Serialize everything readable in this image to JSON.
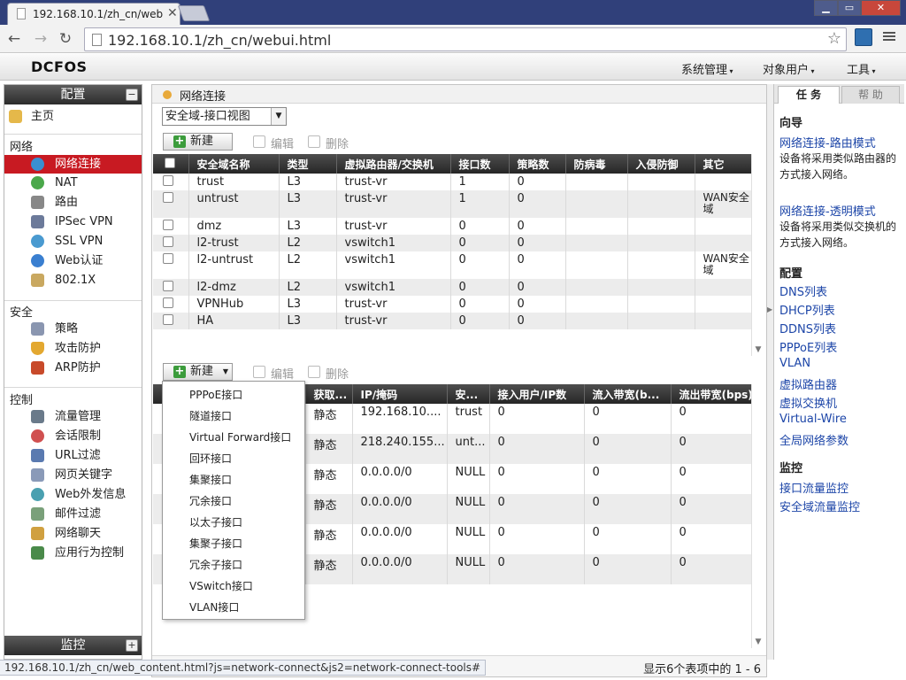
{
  "browser": {
    "tab_title": "192.168.10.1/zh_cn/web",
    "address": "192.168.10.1/zh_cn/webui.html",
    "status_url": "192.168.10.1/zh_cn/web_content.html?js=network-connect&js2=network-connect-tools#"
  },
  "app": {
    "logo": "DCFOS",
    "menus": [
      "系统管理",
      "对象用户",
      "工具"
    ]
  },
  "left": {
    "config_title": "配置",
    "monitor_title": "监控",
    "home": "主页",
    "sections": {
      "network": "网络",
      "security": "安全",
      "control": "控制"
    },
    "network_items": [
      "网络连接",
      "NAT",
      "路由",
      "IPSec VPN",
      "SSL VPN",
      "Web认证",
      "802.1X"
    ],
    "security_items": [
      "策略",
      "攻击防护",
      "ARP防护"
    ],
    "control_items": [
      "流量管理",
      "会话限制",
      "URL过滤",
      "网页关键字",
      "Web外发信息",
      "邮件过滤",
      "网络聊天",
      "应用行为控制"
    ]
  },
  "main": {
    "breadcrumb": "网络连接",
    "view_select": "安全域-接口视图",
    "new_label": "新建",
    "edit_label": "编辑",
    "delete_label": "删除",
    "zone_headers": [
      "安全域名称",
      "类型",
      "虚拟路由器/交换机",
      "接口数",
      "策略数",
      "防病毒",
      "入侵防御",
      "其它"
    ],
    "zones": [
      {
        "name": "trust",
        "type": "L3",
        "vr": "trust-vr",
        "ifc": "1",
        "pol": "0",
        "other": ""
      },
      {
        "name": "untrust",
        "type": "L3",
        "vr": "trust-vr",
        "ifc": "1",
        "pol": "0",
        "other": "WAN安全域"
      },
      {
        "name": "dmz",
        "type": "L3",
        "vr": "trust-vr",
        "ifc": "0",
        "pol": "0",
        "other": ""
      },
      {
        "name": "l2-trust",
        "type": "L2",
        "vr": "vswitch1",
        "ifc": "0",
        "pol": "0",
        "other": ""
      },
      {
        "name": "l2-untrust",
        "type": "L2",
        "vr": "vswitch1",
        "ifc": "0",
        "pol": "0",
        "other": "WAN安全域"
      },
      {
        "name": "l2-dmz",
        "type": "L2",
        "vr": "vswitch1",
        "ifc": "0",
        "pol": "0",
        "other": ""
      },
      {
        "name": "VPNHub",
        "type": "L3",
        "vr": "trust-vr",
        "ifc": "0",
        "pol": "0",
        "other": ""
      },
      {
        "name": "HA",
        "type": "L3",
        "vr": "trust-vr",
        "ifc": "0",
        "pol": "0",
        "other": ""
      }
    ],
    "if_headers": [
      "获取...",
      "IP/掩码",
      "安...",
      "接入用户/IP数",
      "流入带宽(b...",
      "流出带宽(bps)"
    ],
    "interfaces": [
      {
        "mode": "静态",
        "ip": "192.168.10....",
        "zone": "trust",
        "users": "0",
        "in": "0",
        "out": "0"
      },
      {
        "mode": "静态",
        "ip": "218.240.155...",
        "zone": "unt...",
        "users": "0",
        "in": "0",
        "out": "0"
      },
      {
        "mode": "静态",
        "ip": "0.0.0.0/0",
        "zone": "NULL",
        "users": "0",
        "in": "0",
        "out": "0"
      },
      {
        "mode": "静态",
        "ip": "0.0.0.0/0",
        "zone": "NULL",
        "users": "0",
        "in": "0",
        "out": "0"
      },
      {
        "mode": "静态",
        "ip": "0.0.0.0/0",
        "zone": "NULL",
        "users": "0",
        "in": "0",
        "out": "0"
      },
      {
        "mode": "静态",
        "ip": "0.0.0.0/0",
        "zone": "NULL",
        "users": "0",
        "in": "0",
        "out": "0"
      }
    ],
    "new_menu": [
      "PPPoE接口",
      "隧道接口",
      "Virtual Forward接口",
      "回环接口",
      "集聚接口",
      "冗余接口",
      "以太子接口",
      "集聚子接口",
      "冗余子接口",
      "VSwitch接口",
      "VLAN接口"
    ],
    "paging": "显示6个表项中的 1 - 6"
  },
  "right": {
    "tab_tasks": "任 务",
    "tab_help": "帮 助",
    "wizard_title": "向导",
    "wizard_links": [
      {
        "label": "网络连接-路由模式",
        "desc": "设备将采用类似路由器的方式接入网络。"
      },
      {
        "label": "网络连接-透明模式",
        "desc": "设备将采用类似交换机的方式接入网络。"
      }
    ],
    "config_title": "配置",
    "config_links": [
      "DNS列表",
      "DHCP列表",
      "DDNS列表",
      "PPPoE列表",
      "VLAN",
      "虚拟路由器",
      "虚拟交换机",
      "Virtual-Wire",
      "全局网络参数"
    ],
    "monitor_title": "监控",
    "monitor_links": [
      "接口流量监控",
      "安全域流量监控"
    ]
  },
  "colors": {
    "active_nav": "#c81a22",
    "link": "#1d46a8",
    "header_dark": "#262626"
  }
}
